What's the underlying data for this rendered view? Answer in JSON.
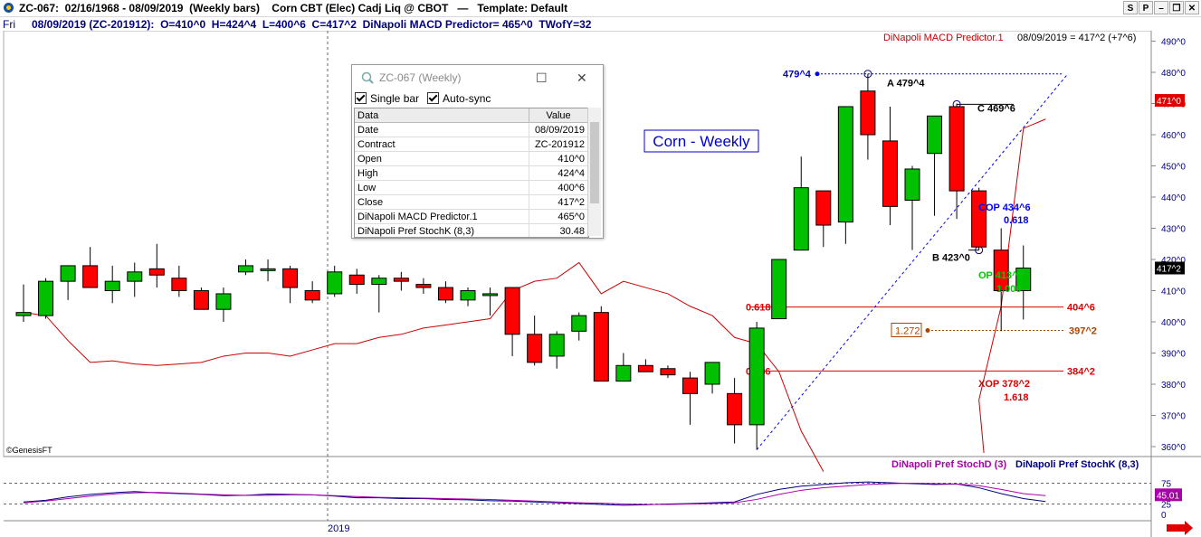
{
  "window": {
    "title": "ZC-067:  02/16/1968 - 08/09/2019  (Weekly bars)    Corn CBT (Elec) Cadj Liq @ CBOT   —   Template: Default",
    "buttons": [
      "S",
      "P",
      "–",
      "❐",
      "✕"
    ]
  },
  "infobar": {
    "day": "Fri",
    "text": "08/09/2019 (ZC-201912):  O=410^0  H=424^4  L=400^6  C=417^2  DiNapoli MACD Predictor= 465^0  TWofY=32"
  },
  "chart": {
    "label_box": "Corn - Weekly",
    "top_right_indicator": "DiNapoli MACD Predictor.1",
    "top_right_date": "08/09/2019 = 417^2 (+7^6)",
    "copyright": "©GenesisFT",
    "x_label": "2019",
    "y_ticks": [
      "490^0",
      "480^0",
      "470^0",
      "460^0",
      "450^0",
      "440^0",
      "430^0",
      "420^0",
      "410^0",
      "400^0",
      "390^0",
      "380^0",
      "370^0",
      "360^0"
    ],
    "price_tag_red": "471^0",
    "price_tag_black": "417^2",
    "annotations": {
      "a_top": "479^4",
      "a_label": "A 479^4",
      "c_label": "C 469^6",
      "b_label": "B 423^0",
      "cop": "COP 434^6",
      "cop_ratio": "0.618",
      "op": "OP 413^2",
      "op_ratio": "1.000",
      "xop": "XOP 378^2",
      "xop_ratio": "1.618",
      "fib_618": "0.618",
      "fib_618_price": "404^6",
      "fib_786": "0.786",
      "fib_786_price": "384^2",
      "ext_1272": "1.272",
      "ext_1272_price": "397^2"
    },
    "colors": {
      "up": "#00c000",
      "down": "#ff0000",
      "macd": "#cc0000",
      "fib": "#dd0000",
      "abc": "#0000ff"
    }
  },
  "chart_data": {
    "type": "candlestick",
    "bars": [
      {
        "o": 402,
        "h": 412,
        "l": 400,
        "c": 403
      },
      {
        "o": 402,
        "h": 414,
        "l": 401,
        "c": 413
      },
      {
        "o": 413,
        "h": 418,
        "l": 407,
        "c": 418
      },
      {
        "o": 418,
        "h": 424,
        "l": 411,
        "c": 411
      },
      {
        "o": 410,
        "h": 418,
        "l": 406,
        "c": 413
      },
      {
        "o": 413,
        "h": 419,
        "l": 408,
        "c": 416
      },
      {
        "o": 417,
        "h": 425,
        "l": 411,
        "c": 415
      },
      {
        "o": 414,
        "h": 418,
        "l": 408,
        "c": 410
      },
      {
        "o": 410,
        "h": 411,
        "l": 404,
        "c": 404
      },
      {
        "o": 404,
        "h": 411,
        "l": 400,
        "c": 409
      },
      {
        "o": 416,
        "h": 420,
        "l": 415,
        "c": 418
      },
      {
        "o": 417,
        "h": 420,
        "l": 413,
        "c": 417
      },
      {
        "o": 417,
        "h": 418,
        "l": 406,
        "c": 411
      },
      {
        "o": 410,
        "h": 413,
        "l": 406,
        "c": 407
      },
      {
        "o": 409,
        "h": 418,
        "l": 408,
        "c": 416
      },
      {
        "o": 415,
        "h": 417,
        "l": 409,
        "c": 412
      },
      {
        "o": 412,
        "h": 415,
        "l": 403,
        "c": 414
      },
      {
        "o": 414,
        "h": 416,
        "l": 410,
        "c": 413
      },
      {
        "o": 412,
        "h": 414,
        "l": 409,
        "c": 411
      },
      {
        "o": 411,
        "h": 413,
        "l": 406,
        "c": 407
      },
      {
        "o": 407,
        "h": 411,
        "l": 405,
        "c": 410
      },
      {
        "o": 409,
        "h": 411,
        "l": 402,
        "c": 409
      },
      {
        "o": 411,
        "h": 411,
        "l": 389,
        "c": 396
      },
      {
        "o": 396,
        "h": 402,
        "l": 386,
        "c": 387
      },
      {
        "o": 389,
        "h": 397,
        "l": 385,
        "c": 396
      },
      {
        "o": 397,
        "h": 403,
        "l": 394,
        "c": 402
      },
      {
        "o": 403,
        "h": 405,
        "l": 381,
        "c": 381
      },
      {
        "o": 381,
        "h": 390,
        "l": 381,
        "c": 386
      },
      {
        "o": 386,
        "h": 388,
        "l": 384,
        "c": 384
      },
      {
        "o": 385,
        "h": 386,
        "l": 382,
        "c": 383
      },
      {
        "o": 382,
        "h": 384,
        "l": 367,
        "c": 377
      },
      {
        "o": 380,
        "h": 387,
        "l": 377,
        "c": 387
      },
      {
        "o": 377,
        "h": 382,
        "l": 361,
        "c": 367
      },
      {
        "o": 367,
        "h": 400,
        "l": 359,
        "c": 398
      },
      {
        "o": 401,
        "h": 420,
        "l": 401,
        "c": 420
      },
      {
        "o": 423,
        "h": 453,
        "l": 423,
        "c": 443
      },
      {
        "o": 442,
        "h": 442,
        "l": 424,
        "c": 431
      },
      {
        "o": 432,
        "h": 469,
        "l": 425,
        "c": 469
      },
      {
        "o": 474,
        "h": 479.5,
        "l": 452,
        "c": 460
      },
      {
        "o": 458,
        "h": 469,
        "l": 431,
        "c": 437
      },
      {
        "o": 439,
        "h": 450,
        "l": 423,
        "c": 449
      },
      {
        "o": 454,
        "h": 466,
        "l": 434,
        "c": 466
      },
      {
        "o": 469,
        "h": 470,
        "l": 433,
        "c": 442
      },
      {
        "o": 442,
        "h": 443,
        "l": 423,
        "c": 424
      },
      {
        "o": 423,
        "h": 430,
        "l": 397,
        "c": 410
      },
      {
        "o": 410,
        "h": 424.5,
        "l": 400.75,
        "c": 417.25
      }
    ],
    "macd_predictor": [
      403,
      402,
      394,
      387,
      387.5,
      386.5,
      386,
      386.5,
      387,
      389,
      390,
      390,
      389,
      391,
      393,
      393,
      395,
      396,
      398,
      399,
      400,
      401,
      410,
      413,
      414,
      419,
      409,
      413,
      411,
      409,
      405,
      402,
      395,
      393,
      384,
      365,
      352
    ]
  }
}
